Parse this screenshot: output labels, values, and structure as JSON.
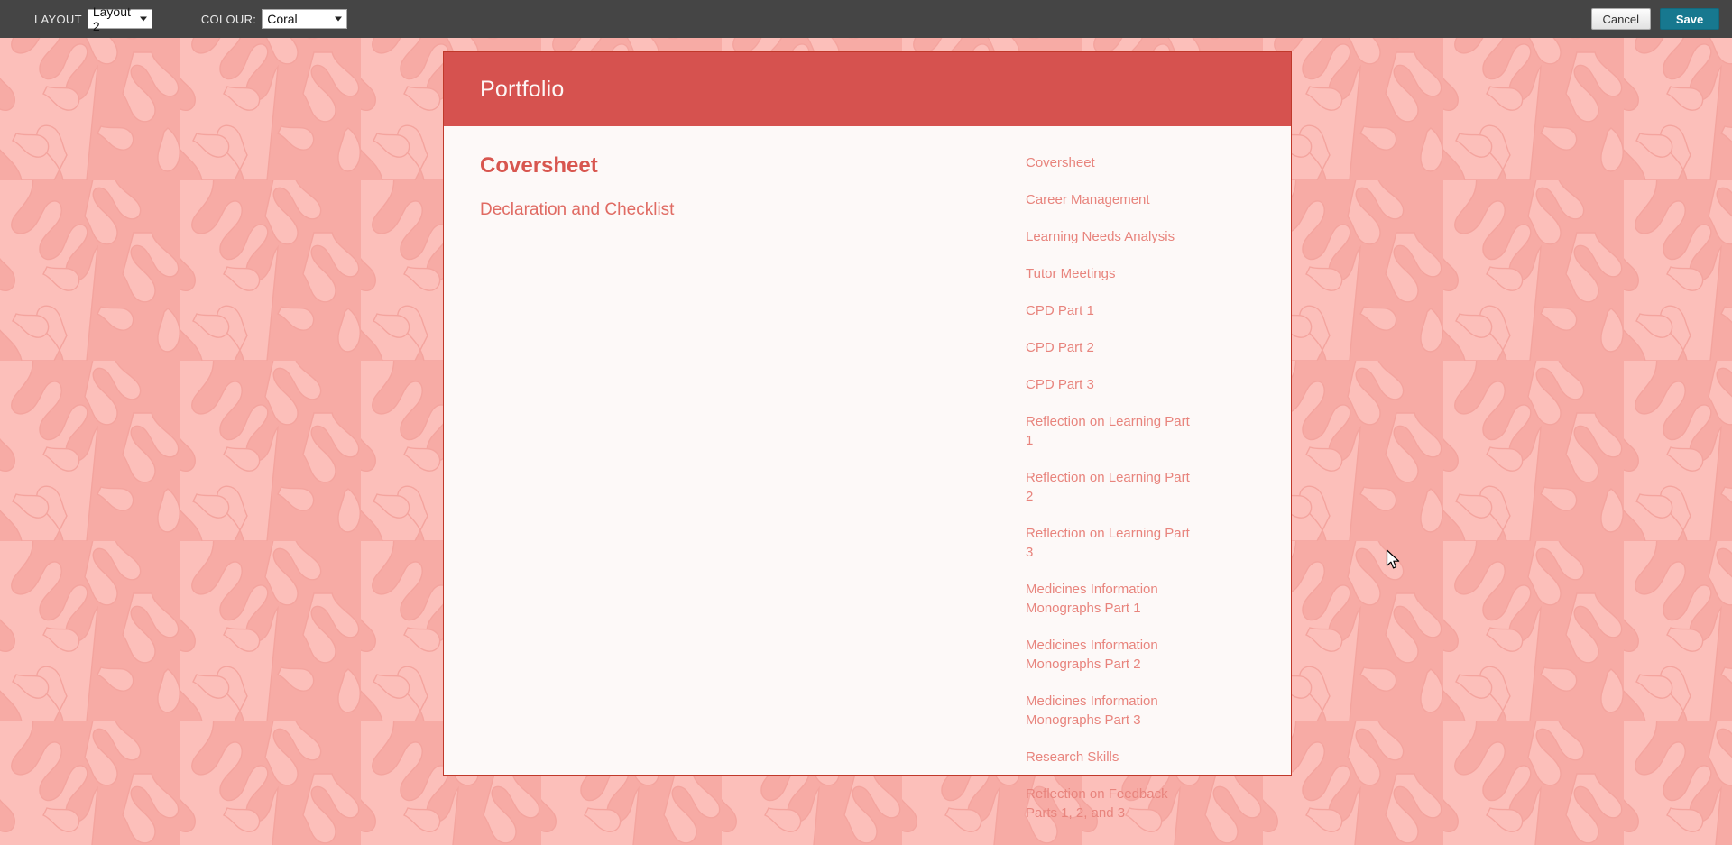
{
  "toolbar": {
    "layout_label": "LAYOUT",
    "layout_value": "Layout 2",
    "colour_label": "COLOUR:",
    "colour_value": "Coral",
    "cancel_label": "Cancel",
    "save_label": "Save"
  },
  "card": {
    "header_title": "Portfolio",
    "section_title": "Coversheet",
    "section_subtitle": "Declaration and Checklist"
  },
  "nav": {
    "items": [
      {
        "label": "Coversheet"
      },
      {
        "label": "Career Management"
      },
      {
        "label": "Learning Needs Analysis"
      },
      {
        "label": "Tutor Meetings"
      },
      {
        "label": "CPD Part 1"
      },
      {
        "label": "CPD Part 2"
      },
      {
        "label": "CPD Part 3"
      },
      {
        "label": "Reflection on Learning Part 1"
      },
      {
        "label": "Reflection on Learning Part 2"
      },
      {
        "label": "Reflection on Learning Part 3"
      },
      {
        "label": "Medicines Information Monographs Part 1"
      },
      {
        "label": "Medicines Information Monographs Part 2"
      },
      {
        "label": "Medicines Information Monographs Part 3"
      },
      {
        "label": "Research Skills"
      },
      {
        "label": "Reflection on Feedback Parts 1, 2, and 3"
      }
    ]
  },
  "colors": {
    "toolbar_bg": "#454545",
    "save_bg": "#17788f",
    "accent_coral": "#d6524f",
    "section_title": "#d8564f",
    "nav_link": "#e8847d",
    "page_bg": "#f7aba5",
    "page_bg_pattern": "#fcbfba",
    "card_bg": "#fdf9f8"
  }
}
